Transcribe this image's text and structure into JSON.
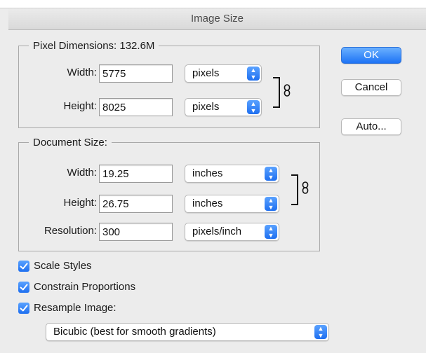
{
  "window": {
    "title": "Image Size"
  },
  "pixel_dimensions": {
    "legend": "Pixel Dimensions:  132.6M",
    "width_label": "Width:",
    "width_value": "5775",
    "width_unit": "pixels",
    "height_label": "Height:",
    "height_value": "8025",
    "height_unit": "pixels"
  },
  "document_size": {
    "legend": "Document Size:",
    "width_label": "Width:",
    "width_value": "19.25",
    "width_unit": "inches",
    "height_label": "Height:",
    "height_value": "26.75",
    "height_unit": "inches",
    "resolution_label": "Resolution:",
    "resolution_value": "300",
    "resolution_unit": "pixels/inch"
  },
  "buttons": {
    "ok": "OK",
    "cancel": "Cancel",
    "auto": "Auto..."
  },
  "options": {
    "scale_styles": {
      "label": "Scale Styles",
      "checked": true
    },
    "constrain_proportions": {
      "label": "Constrain Proportions",
      "checked": true
    },
    "resample_image": {
      "label": "Resample Image:",
      "checked": true
    }
  },
  "resample_method": "Bicubic (best for smooth gradients)",
  "colors": {
    "accent": "#1e6ff0",
    "dialog_bg": "#ececec"
  }
}
